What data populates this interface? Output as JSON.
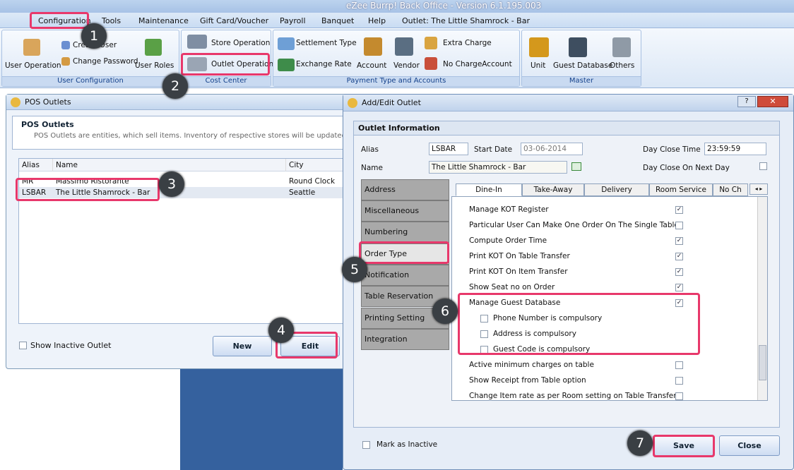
{
  "app": {
    "title": "eZee Burrp! Back Office - Version 6.1.195.003"
  },
  "menu": [
    "Configuration",
    "Tools",
    "Maintenance",
    "Gift Card/Voucher",
    "Payroll",
    "Banquet",
    "Help",
    "Outlet: The Little Shamrock - Bar"
  ],
  "ribbon": {
    "user_config": {
      "user_operation": "User Operation",
      "create_user": "Create User",
      "change_password": "Change Password",
      "user_roles": "User Roles",
      "group": "User Configuration"
    },
    "cost_center": {
      "store_operation": "Store Operation",
      "outlet_operation": "Outlet Operation",
      "group": "Cost Center"
    },
    "payment": {
      "settlement_type": "Settlement Type",
      "exchange_rate": "Exchange Rate",
      "account": "Account",
      "vendor": "Vendor",
      "extra_charge": "Extra Charge",
      "no_charge_account": "No ChargeAccount",
      "group": "Payment Type and Accounts"
    },
    "master": {
      "unit": "Unit",
      "guest_database": "Guest Database",
      "others": "Others",
      "group": "Master"
    }
  },
  "pos_window": {
    "title": "POS Outlets",
    "heading": "POS Outlets",
    "description": "POS Outlets are entities, which sell items. Inventory of respective stores will be updated with each",
    "columns": [
      "Alias",
      "Name",
      "City"
    ],
    "rows": [
      [
        "MR",
        "Massimo Ristorante",
        "Round Clock"
      ],
      [
        "LSBAR",
        "The Little Shamrock - Bar",
        "Seattle"
      ]
    ],
    "show_inactive": "Show Inactive Outlet",
    "new_label": "New",
    "edit_label": "Edit"
  },
  "edit_window": {
    "title": "Add/Edit Outlet",
    "section": "Outlet Information",
    "alias_label": "Alias",
    "alias_value": "LSBAR",
    "start_date_label": "Start Date",
    "start_date_value": "03-06-2014",
    "day_close_time_label": "Day Close Time",
    "day_close_time_value": "23:59:59",
    "name_label": "Name",
    "name_value": "The Little Shamrock - Bar",
    "day_close_next_label": "Day Close On Next Day",
    "side_items": [
      "Address",
      "Miscellaneous",
      "Numbering",
      "Order Type",
      "Notification",
      "Table Reservation",
      "Printing Setting",
      "Integration"
    ],
    "tabs": [
      "Dine-In",
      "Take-Away",
      "Delivery",
      "Room Service",
      "No Ch"
    ],
    "options": [
      {
        "label": "Manage KOT Register",
        "checked": true
      },
      {
        "label": "Particular User Can Make One Order On The Single Table",
        "checked": false
      },
      {
        "label": "Compute Order Time",
        "checked": true
      },
      {
        "label": "Print KOT On Table Transfer",
        "checked": true
      },
      {
        "label": "Print KOT On Item Transfer",
        "checked": true
      },
      {
        "label": "Show Seat no on Order",
        "checked": true
      },
      {
        "label": "Manage Guest Database",
        "checked": true
      },
      {
        "label": "Phone Number is compulsory",
        "checked": false
      },
      {
        "label": "Address is compulsory",
        "checked": false
      },
      {
        "label": "Guest Code is compulsory",
        "checked": false
      },
      {
        "label": "Active minimum charges on table",
        "checked": false
      },
      {
        "label": "Show Receipt from Table option",
        "checked": false
      },
      {
        "label": "Change Item rate as per Room setting on Table Transfer",
        "checked": false
      }
    ],
    "mark_inactive": "Mark as Inactive",
    "save_label": "Save",
    "close_label": "Close"
  },
  "badges": [
    "1",
    "2",
    "3",
    "4",
    "5",
    "6",
    "7"
  ],
  "colors": {
    "highlight": "#e8386b",
    "badge": "#3a3f44",
    "accent": "#15428b"
  }
}
